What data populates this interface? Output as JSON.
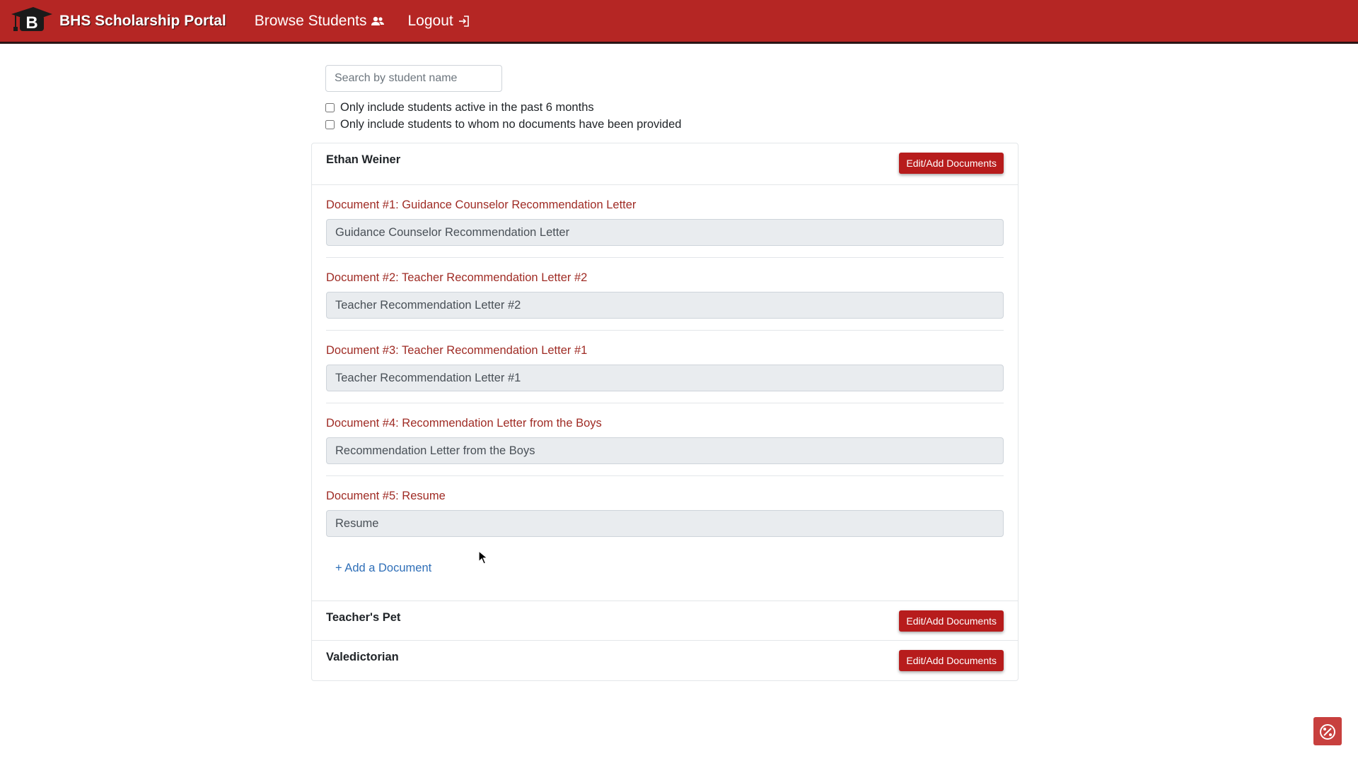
{
  "navbar": {
    "brand_letter": "B",
    "brand_text": "BHS Scholarship Portal",
    "browse_label": "Browse Students",
    "browse_icon": "people-icon",
    "logout_label": "Logout",
    "logout_icon": "logout-arrow-icon",
    "color": "#b52624"
  },
  "filters": {
    "search_placeholder": "Search by student name",
    "search_value": "",
    "active_6_months_label": "Only include students active in the past 6 months",
    "active_6_months_checked": false,
    "no_documents_label": "Only include students to whom no documents have been provided",
    "no_documents_checked": false
  },
  "students": [
    {
      "name": "Ethan Weiner",
      "button_label": "Edit/Add Documents",
      "expanded": true,
      "documents": [
        {
          "label": "Document #1: Guidance Counselor Recommendation Letter",
          "value": "Guidance Counselor Recommendation Letter"
        },
        {
          "label": "Document #2: Teacher Recommendation Letter #2",
          "value": "Teacher Recommendation Letter #2"
        },
        {
          "label": "Document #3: Teacher Recommendation Letter #1",
          "value": "Teacher Recommendation Letter #1"
        },
        {
          "label": "Document #4: Recommendation Letter from the Boys",
          "value": "Recommendation Letter from the Boys"
        },
        {
          "label": "Document #5: Resume",
          "value": "Resume"
        }
      ],
      "add_document_label": "+ Add a Document"
    },
    {
      "name": "Teacher's Pet",
      "button_label": "Edit/Add Documents",
      "expanded": false
    },
    {
      "name": "Valedictorian",
      "button_label": "Edit/Add Documents",
      "expanded": false
    }
  ],
  "colors": {
    "accent": "#b71c1c",
    "doc_label": "#9f2b24",
    "link": "#2f6fb8"
  }
}
